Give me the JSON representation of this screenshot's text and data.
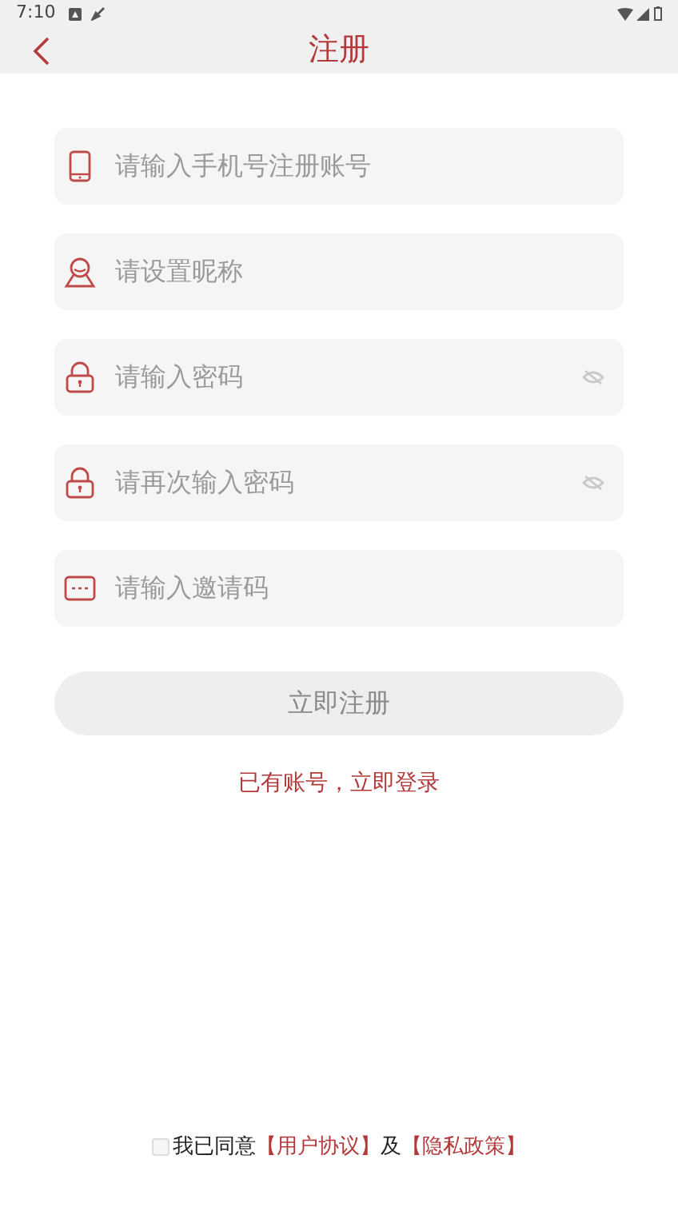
{
  "status_bar": {
    "time": "7:10"
  },
  "header": {
    "title": "注册"
  },
  "fields": [
    {
      "kind": "phone",
      "placeholder": "请输入手机号注册账号",
      "password": false
    },
    {
      "kind": "person",
      "placeholder": "请设置昵称",
      "password": false
    },
    {
      "kind": "lock",
      "placeholder": "请输入密码",
      "password": true
    },
    {
      "kind": "lock",
      "placeholder": "请再次输入密码",
      "password": true
    },
    {
      "kind": "code",
      "placeholder": "请输入邀请码",
      "password": false
    }
  ],
  "submit_button": {
    "label": "立即注册",
    "disabled": true
  },
  "login_link": "已有账号，立即登录",
  "agreement": {
    "checked": false,
    "prefix": "我已同意",
    "user_agreement": "【用户协议】",
    "joiner": "及",
    "privacy_policy": "【隐私政策】"
  }
}
